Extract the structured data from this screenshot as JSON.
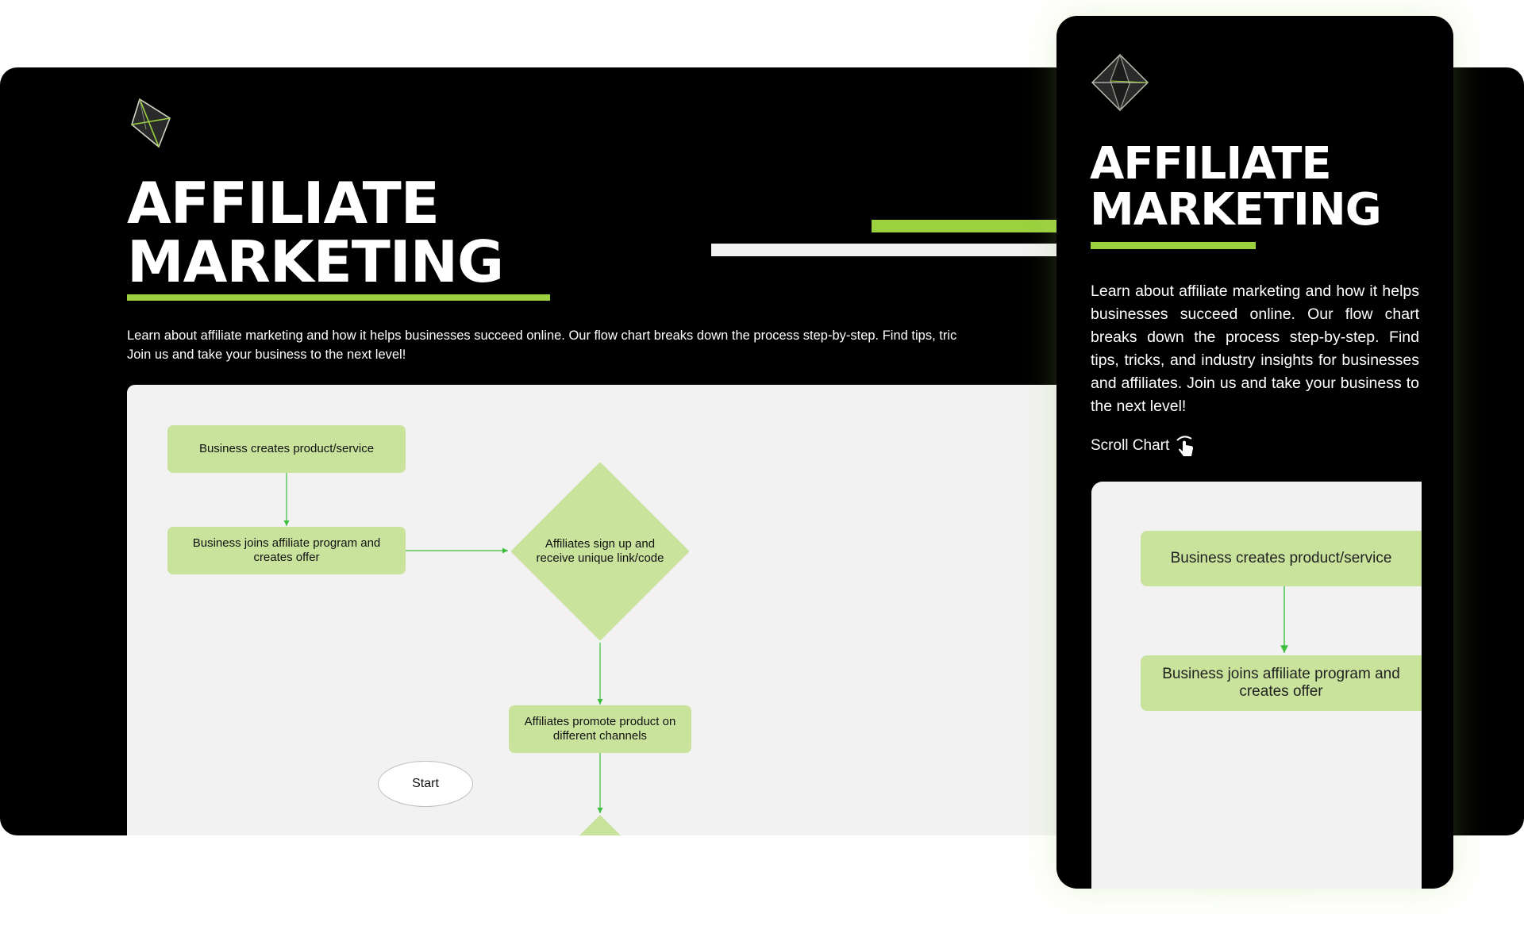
{
  "desktop": {
    "title_line1": "AFFILIATE",
    "title_line2": "MARKETING",
    "description_line1": "Learn about affiliate marketing and how it helps businesses succeed online. Our flow chart breaks down the process step-by-step. Find tips, tric",
    "description_line2": "Join us and take your business to the next level!",
    "flowchart": {
      "node_create": "Business creates product/service",
      "node_join": "Business joins affiliate program and creates offer",
      "node_signup": "Affiliates sign up and receive unique link/code",
      "node_promote": "Affiliates promote product on different channels",
      "node_start": "Start"
    }
  },
  "mobile": {
    "title_line1": "AFFILIATE",
    "title_line2": "MARKETING",
    "description": "Learn about affiliate marketing and how it helps businesses succeed online. Our flow chart breaks down the process step-by-step. Find tips, tricks, and industry insights for businesses and affiliates. Join us and take your business to the next level!",
    "scroll_label": "Scroll Chart",
    "flowchart": {
      "node_create": "Business creates product/service",
      "node_join": "Business joins affiliate program and creates offer"
    }
  },
  "colors": {
    "accent": "#9bd13f",
    "node_fill": "#c9e39d",
    "background": "#000000",
    "canvas": "#f2f2f2"
  },
  "icons": [
    "octahedron-logo-icon",
    "tap-hand-icon"
  ]
}
